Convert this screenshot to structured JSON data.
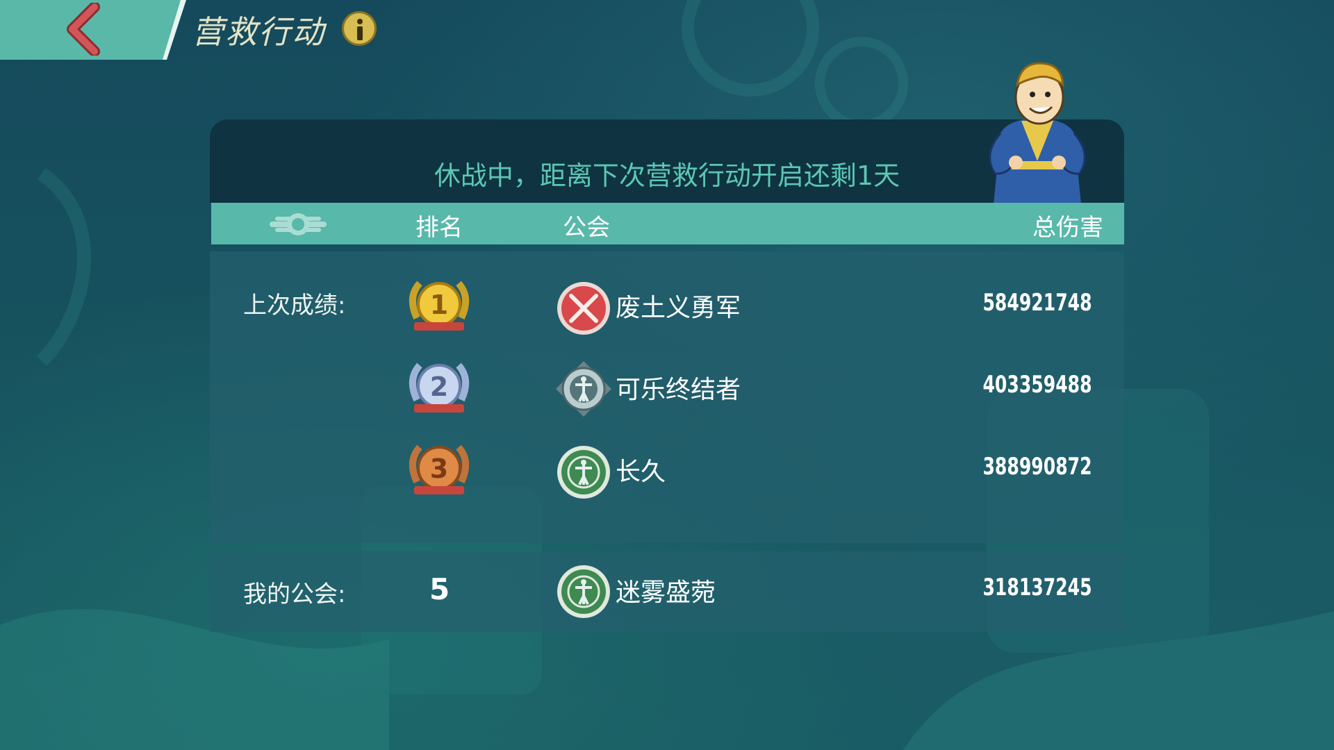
{
  "header": {
    "title": "营救行动"
  },
  "status": {
    "text": "休战中，距离下次营救行动开启还剩1天"
  },
  "columns": {
    "rank": "排名",
    "guild": "公会",
    "damage": "总伤害"
  },
  "last_results": {
    "label": "上次成绩:",
    "rows": [
      {
        "rank": "1",
        "medal": "gold",
        "emblem": "red-crossed-swords-emblem",
        "guild": "废土义勇军",
        "damage": "584921748"
      },
      {
        "rank": "2",
        "medal": "silver",
        "emblem": "silver-vitruvian-emblem",
        "guild": "可乐终结者",
        "damage": "403359488"
      },
      {
        "rank": "3",
        "medal": "bronze",
        "emblem": "green-vitruvian-emblem",
        "guild": "长久",
        "damage": "388990872"
      }
    ]
  },
  "my_guild": {
    "label": "我的公会:",
    "rank": "5",
    "emblem": "green-vitruvian-emblem",
    "guild": "迷雾盛菀",
    "damage": "318137245"
  },
  "colors": {
    "accent": "#58b8aa",
    "status_text": "#5cc7b4",
    "panel_dark": "#0f3340",
    "title": "#e3e3c6",
    "back_arrow": "#d2555a"
  }
}
